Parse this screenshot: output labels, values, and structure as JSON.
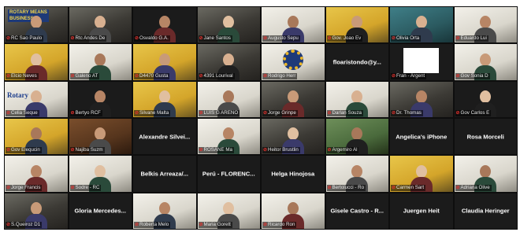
{
  "tiles": [
    {
      "name": "RC Sao Paulo",
      "style": "video",
      "overlay": "banner",
      "banner_text": "ROTARY MEANS BUSINESS FELLOWSHIP"
    },
    {
      "name": "Rtc Andes De",
      "style": "video"
    },
    {
      "name": "Osvaldo G.A.",
      "style": "dark"
    },
    {
      "name": "Jane Santos",
      "style": "video"
    },
    {
      "name": "Augusto Sepu",
      "style": "white"
    },
    {
      "name": "Gov. Joao Ev",
      "style": "yellow"
    },
    {
      "name": "Olivia Orta",
      "style": "teal"
    },
    {
      "name": "Eduardo Lui",
      "style": "white"
    },
    {
      "name": "Elcio Neves",
      "style": "yellow"
    },
    {
      "name": "Galeno AT",
      "style": "white"
    },
    {
      "name": "D4470 Gusta",
      "style": "yellow"
    },
    {
      "name": "4391 Lourival",
      "style": "video"
    },
    {
      "name": "Rodrigo Herr",
      "style": "white",
      "overlay": "wheel"
    },
    {
      "center": "floaristondo@y...",
      "style": "dark"
    },
    {
      "name": "Fran - Argent",
      "style": "dark",
      "overlay": "whitebox"
    },
    {
      "name": "Gov Sonia D",
      "style": "white"
    },
    {
      "name": "Celia Seque",
      "style": "white",
      "overlay": "rotary",
      "rotary_text": "Rotary"
    },
    {
      "name": "Bertyo RCF",
      "style": "dark"
    },
    {
      "name": "Silvane Malta",
      "style": "yellow"
    },
    {
      "name": "LUIS G ARENO",
      "style": "white"
    },
    {
      "name": "Jorge Grinpe",
      "style": "video"
    },
    {
      "name": "Darlan Souza",
      "style": "white"
    },
    {
      "name": "Dr. Thomas",
      "style": "video"
    },
    {
      "name": "Gov Carlos E",
      "style": "dark"
    },
    {
      "name": "Gov Elequcin",
      "style": "yellow"
    },
    {
      "name": "Najiba Suzm",
      "style": "wood"
    },
    {
      "center": "Alexandre Silvei...",
      "style": "dark"
    },
    {
      "name": "ROSANE Ma",
      "style": "white"
    },
    {
      "name": "Heitor Brustlin",
      "style": "video"
    },
    {
      "name": "Argemiro Al",
      "style": "green"
    },
    {
      "center": "Angelica's iPhone",
      "style": "dark"
    },
    {
      "center": "Rosa Morceli",
      "style": "dark"
    },
    {
      "name": "Jorge Francis",
      "style": "white"
    },
    {
      "name": "Sodre - RC",
      "style": "white"
    },
    {
      "center": "Belkis Arreaza/...",
      "style": "dark"
    },
    {
      "center": "Perú - FLORENC...",
      "style": "dark"
    },
    {
      "center": "Helga Hinojosa",
      "style": "dark"
    },
    {
      "name": "Bertolucci - Ro",
      "style": "white"
    },
    {
      "name": "Carmen Sart",
      "style": "yellow"
    },
    {
      "name": "Adriana Olive",
      "style": "white"
    },
    {
      "name": "S.Queiroz D1",
      "style": "video"
    },
    {
      "center": "Gloria Mercedes...",
      "style": "dark"
    },
    {
      "name": "Roberta Melo",
      "style": "white"
    },
    {
      "name": "Maria Gorett",
      "style": "white"
    },
    {
      "name": "Ricardo Ron",
      "style": "white"
    },
    {
      "center": "Gisele Castro - R...",
      "style": "dark"
    },
    {
      "center": "Juergen Heit",
      "style": "dark"
    },
    {
      "center": "Claudia Heringer",
      "style": "dark"
    }
  ]
}
